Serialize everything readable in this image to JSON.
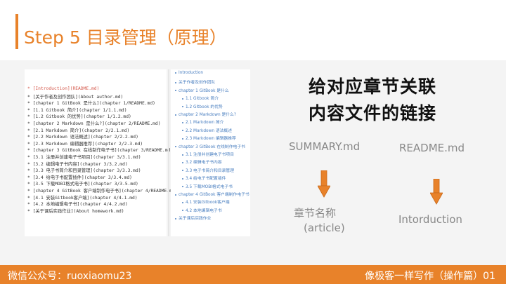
{
  "title": "Step 5 目录管理（原理）",
  "summary_lines": [
    {
      "text": "* [Introduction](README.md)",
      "color": "#d4574a"
    },
    {
      "text": "* [关于作者及创作团队](About author.md)",
      "color": "#333333"
    },
    {
      "text": "* [chapter 1 GitBook 是什么](chapter 1/README.md)",
      "color": "#333333"
    },
    {
      "text": "  * [1.1 Gitbook 简介](chapter 1/1.1.md)",
      "color": "#333333"
    },
    {
      "text": "  * [1.2 Gitbook 的优势](chapter 1/1.2.md)",
      "color": "#333333"
    },
    {
      "text": "* [chapter 2 Markdown 是什么?](chapter 2/README.md)",
      "color": "#333333"
    },
    {
      "text": "  * [2.1 Markdown 简介](chapter 2/2.1.md)",
      "color": "#333333"
    },
    {
      "text": "  * [2.2 Markdown 语法概述](chapter 2/2.2.md)",
      "color": "#333333"
    },
    {
      "text": "  * [2.3 Markdown 编辑器推荐](chapter 2/2.3.md)",
      "color": "#333333"
    },
    {
      "text": "* [chapter 3 GitBook 在线制作电子书](chapter 3/README.md)",
      "color": "#333333"
    },
    {
      "text": "  * [3.1 注册并创建电子书项目](chapter 3/3.1.md)",
      "color": "#333333"
    },
    {
      "text": "  * [3.2 编辑电子书内容](chapter 3/3.2.md)",
      "color": "#333333"
    },
    {
      "text": "  * [3.3 电子书简介和目录管理](chapter 3/3.3.md)",
      "color": "#333333"
    },
    {
      "text": "  * [3.4 给电子书配置插件](chapter 3/3.4.md)",
      "color": "#333333"
    },
    {
      "text": "  * [3.5 下载MOBI格式电子书](chapter 3/3.5.md)",
      "color": "#333333"
    },
    {
      "text": "* [chapter 4 GitBook 客户端制作电子书](chapter 4/README.md)",
      "color": "#333333"
    },
    {
      "text": "  * [4.1 安装Gitbook客户端](chapter 4/4.1.md)",
      "color": "#333333"
    },
    {
      "text": "  * [4.2 本地编辑电子书](chapter 4/4.2.md)",
      "color": "#333333"
    },
    {
      "text": "* [关于课后实践作业](About homework.md)",
      "color": "#333333"
    }
  ],
  "toc_lines": [
    {
      "text": "Introduction",
      "indent": 0
    },
    {
      "text": "关于作者及创作团队",
      "indent": 0
    },
    {
      "text": "chapter 1 GitBook 是什么",
      "indent": 0
    },
    {
      "text": "1.1 Gitbook 简介",
      "indent": 1
    },
    {
      "text": "1.2 Gitbook 的优势",
      "indent": 1
    },
    {
      "text": "chapter 2 Markdown 是什么?",
      "indent": 0
    },
    {
      "text": "2.1 Markdown 简介",
      "indent": 1
    },
    {
      "text": "2.2 Markdown 语法概述",
      "indent": 1
    },
    {
      "text": "2.3 Markdown 编辑器推荐",
      "indent": 1
    },
    {
      "text": "chapter 3 GitBook 在线制作电子书",
      "indent": 0
    },
    {
      "text": "3.1 注册并创建电子书项目",
      "indent": 1
    },
    {
      "text": "3.2 编辑电子书内容",
      "indent": 1
    },
    {
      "text": "3.3 电子书简介和目录管理",
      "indent": 1
    },
    {
      "text": "3.4 给电子书配置插件",
      "indent": 1
    },
    {
      "text": "3.5 下载MOBI格式电子书",
      "indent": 1
    },
    {
      "text": "chapter 4 GitBook 客户端制作电子书",
      "indent": 0
    },
    {
      "text": "4.1 安装Gitbook客户端",
      "indent": 1
    },
    {
      "text": "4.2 本地编辑电子书",
      "indent": 1
    },
    {
      "text": "关于课后实践作业",
      "indent": 0
    }
  ],
  "heading_line1": "给对应章节关联",
  "heading_line2": "内容文件的链接",
  "summary_label": "SUMMARY.md",
  "readme_label": "README.md",
  "chapter_label_line1": "章节名称",
  "chapter_label_line2": "(article)",
  "intorduction_label": "Intorduction",
  "footer_left": "微信公众号：ruoxiaomu23",
  "footer_right": "像极客一样写作（操作篇）01",
  "colors": {
    "accent": "#e8822a",
    "link": "#4a7fc0",
    "md_red": "#d4574a"
  }
}
